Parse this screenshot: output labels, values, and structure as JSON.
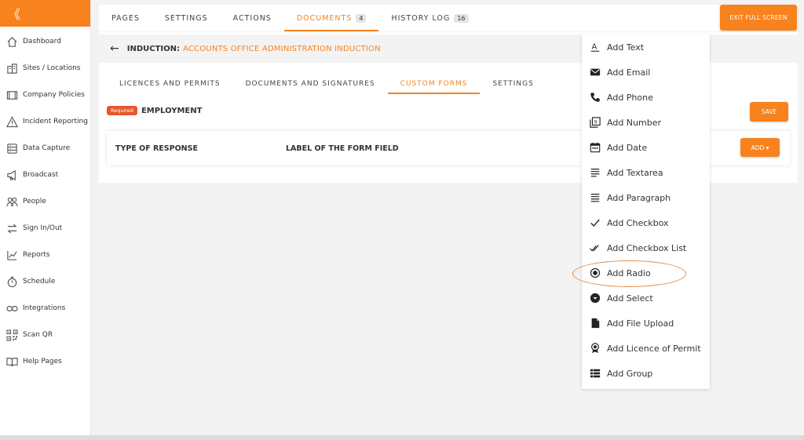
{
  "sidebar": {
    "collapse_glyph": "《",
    "items": [
      {
        "label": "Dashboard",
        "icon": "home-icon"
      },
      {
        "label": "Sites / Locations",
        "icon": "building-icon"
      },
      {
        "label": "Company Policies",
        "icon": "book-icon"
      },
      {
        "label": "Incident Reporting",
        "icon": "warning-icon"
      },
      {
        "label": "Data Capture",
        "icon": "database-icon"
      },
      {
        "label": "Broadcast",
        "icon": "megaphone-icon"
      },
      {
        "label": "People",
        "icon": "people-icon"
      },
      {
        "label": "Sign In/Out",
        "icon": "swap-icon"
      },
      {
        "label": "Reports",
        "icon": "chart-icon"
      },
      {
        "label": "Schedule",
        "icon": "stopwatch-icon"
      },
      {
        "label": "Integrations",
        "icon": "link-icon"
      },
      {
        "label": "Scan QR",
        "icon": "qr-icon"
      },
      {
        "label": "Help Pages",
        "icon": "open-book-icon"
      }
    ]
  },
  "topbar": {
    "tabs": [
      {
        "label": "PAGES"
      },
      {
        "label": "SETTINGS"
      },
      {
        "label": "ACTIONS"
      },
      {
        "label": "DOCUMENTS",
        "badge": "4"
      },
      {
        "label": "HISTORY LOG",
        "badge": "16"
      }
    ],
    "active_index": 3,
    "exit_label": "EXIT FULL SCREEN"
  },
  "breadcrumb": {
    "label": "INDUCTION:",
    "name": "ACCOUNTS OFFICE ADMINISTRATION INDUCTION"
  },
  "subtabs": {
    "items": [
      "LICENCES AND PERMITS",
      "DOCUMENTS AND SIGNATURES",
      "CUSTOM FORMS",
      "SETTINGS"
    ],
    "active_index": 2
  },
  "form": {
    "required_tag": "Required",
    "title": "EMPLOYMENT",
    "save_label": "SAVE",
    "col_type": "TYPE OF RESPONSE",
    "col_label": "LABEL OF THE FORM FIELD",
    "add_label": "ADD ▾"
  },
  "menu": {
    "items": [
      {
        "label": "Add Text",
        "icon": "text-icon"
      },
      {
        "label": "Add Email",
        "icon": "email-icon"
      },
      {
        "label": "Add Phone",
        "icon": "phone-icon"
      },
      {
        "label": "Add Number",
        "icon": "number-icon"
      },
      {
        "label": "Add Date",
        "icon": "calendar-icon"
      },
      {
        "label": "Add Textarea",
        "icon": "textarea-icon"
      },
      {
        "label": "Add Paragraph",
        "icon": "paragraph-icon"
      },
      {
        "label": "Add Checkbox",
        "icon": "check-icon"
      },
      {
        "label": "Add Checkbox List",
        "icon": "double-check-icon"
      },
      {
        "label": "Add Radio",
        "icon": "radio-icon"
      },
      {
        "label": "Add Select",
        "icon": "select-icon"
      },
      {
        "label": "Add File Upload",
        "icon": "file-icon"
      },
      {
        "label": "Add Licence of Permit",
        "icon": "award-icon"
      },
      {
        "label": "Add Group",
        "icon": "group-icon"
      }
    ],
    "highlighted": "Add Radio"
  },
  "colors": {
    "accent": "#f7821e",
    "required": "#e4582b",
    "highlight_ring": "#e98a3c"
  }
}
